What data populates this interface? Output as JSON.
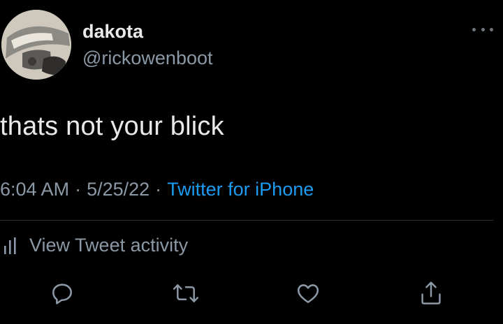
{
  "author": {
    "display_name": "dakota",
    "handle": "@rickowenboot"
  },
  "tweet": {
    "text": "thats not your blick",
    "time": "6:04 AM",
    "date": "5/25/22",
    "separator": "·",
    "source": "Twitter for iPhone"
  },
  "activity": {
    "label": "View Tweet activity"
  },
  "actions": [
    "reply-icon",
    "retweet-icon",
    "like-icon",
    "share-icon"
  ],
  "colors": {
    "background": "#000000",
    "primary_text": "#e7e9ea",
    "secondary_text": "#8b98a5",
    "link": "#1d9bf0"
  }
}
